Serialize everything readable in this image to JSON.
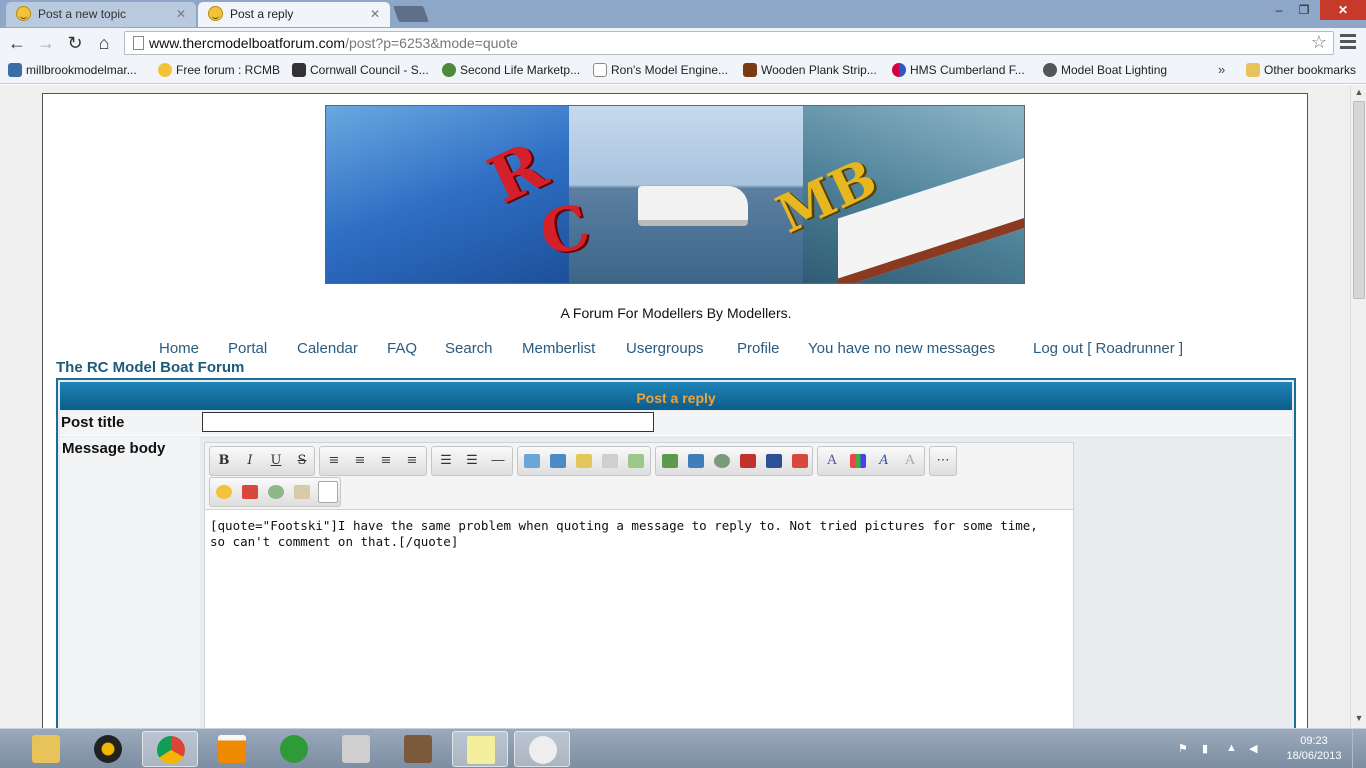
{
  "browser": {
    "tabs": [
      {
        "label": "Post a new topic",
        "active": false
      },
      {
        "label": "Post a reply",
        "active": true
      }
    ],
    "url_host": "www.thercmodelboatforum.com",
    "url_path": "/post?p=6253&mode=quote",
    "window_controls": {
      "minimize": "–",
      "maximize": "❐",
      "close": "✕"
    },
    "bookmarks": [
      "millbrookmodelmar...",
      "Free forum : RCMB",
      "Cornwall Council - S...",
      "Second Life Marketp...",
      "Ron's Model Engine...",
      "Wooden Plank Strip...",
      "HMS Cumberland F...",
      "Model Boat Lighting"
    ],
    "bookmarks_overflow": "»",
    "other_bookmarks": "Other bookmarks"
  },
  "page": {
    "tagline": "A Forum For Modellers By Modellers.",
    "nav": [
      "Home",
      "Portal",
      "Calendar",
      "FAQ",
      "Search",
      "Memberlist",
      "Usergroups",
      "Profile",
      "You have no new messages",
      "Log out [ Roadrunner ]"
    ],
    "forum_title": "The RC Model Boat Forum",
    "post_header": "Post a reply",
    "post_title_label": "Post title",
    "post_title_value": "",
    "message_body_label": "Message body",
    "message_body": "[quote=\"Footski\"]I have the same problem when quoting a message to reply to. Not tried pictures for some time, so can't comment on that.[/quote]",
    "toolbar": {
      "bold": "B",
      "italic": "I",
      "underline": "U",
      "strike": "S"
    }
  },
  "taskbar": {
    "apps": [
      "file-explorer",
      "audio-player",
      "chrome",
      "vlc",
      "utorrent",
      "monitor",
      "game",
      "sticky-notes",
      "paint"
    ],
    "active_app": "chrome",
    "time": "09:23",
    "date": "18/06/2013"
  },
  "colors": {
    "tab_strip": "#8ea7c9",
    "post_header_bg": "#0c5d8b",
    "post_header_text": "#f2a23a",
    "nav_link": "#2a5b80"
  }
}
